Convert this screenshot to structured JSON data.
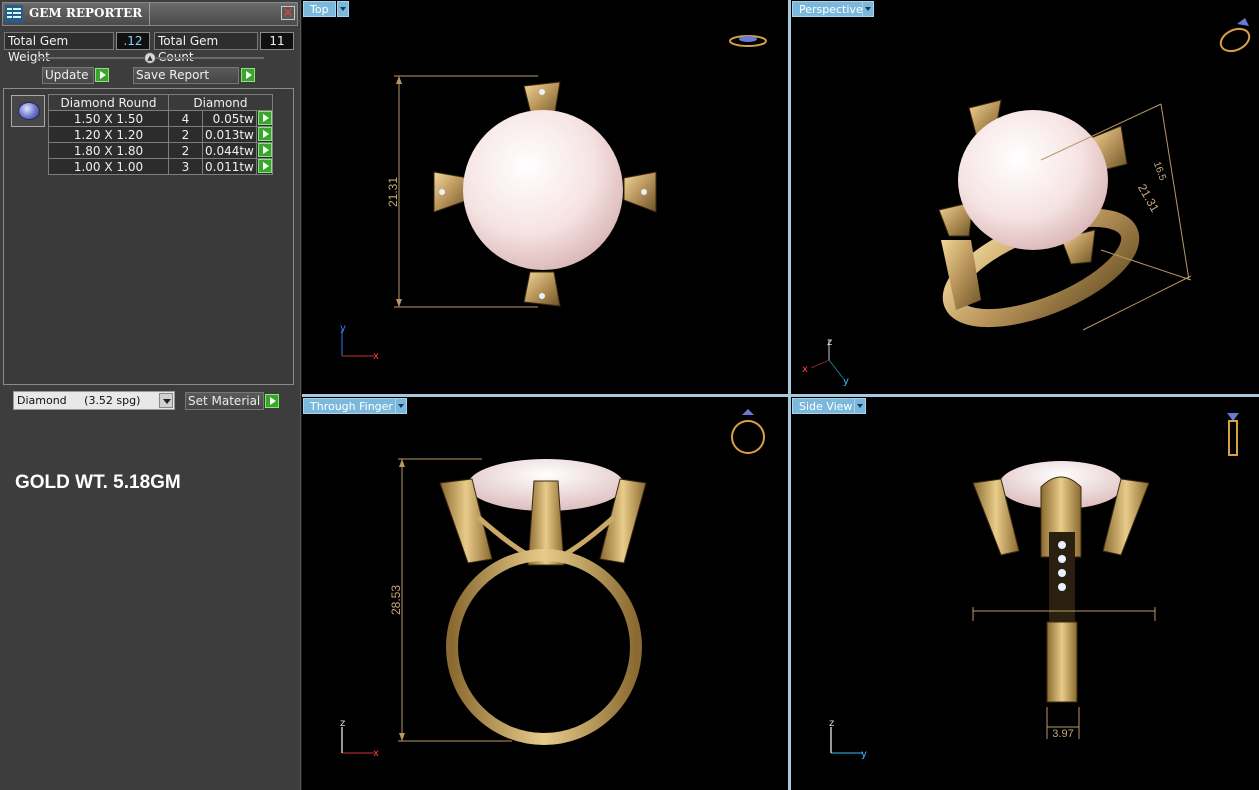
{
  "panel": {
    "title": "GEM REPORTER",
    "total_weight_label": "Total Gem Weight",
    "total_weight_value": ".12",
    "total_count_label": "Total Gem Count",
    "total_count_value": "11",
    "update_label": "Update",
    "save_report_label": "Save Report",
    "table": {
      "headers": [
        "Diamond Round",
        "Diamond"
      ],
      "rows": [
        {
          "size": "1.50 X 1.50",
          "count": "4",
          "weight": "0.05tw"
        },
        {
          "size": "1.20 X 1.20",
          "count": "2",
          "weight": "0.013tw"
        },
        {
          "size": "1.80 X 1.80",
          "count": "2",
          "weight": "0.044tw"
        },
        {
          "size": "1.00 X 1.00",
          "count": "3",
          "weight": "0.011tw"
        }
      ]
    },
    "material_selected": "Diamond     (3.52 spg)",
    "set_material_label": "Set Material",
    "gold_weight": "GOLD WT. 5.18GM"
  },
  "viewports": {
    "top": {
      "label": "Top",
      "dimension": "21.31",
      "axis_a": "y",
      "axis_b": "x"
    },
    "perspective": {
      "label": "Perspective",
      "dimension_a": "21.31",
      "dimension_b": "16.5",
      "axis_a": "z",
      "axis_b": "x",
      "axis_c": "y"
    },
    "through_finger": {
      "label": "Through Finger",
      "dimension": "28.53",
      "axis_a": "z",
      "axis_b": "x"
    },
    "side_view": {
      "label": "Side View",
      "dimension": "3.97",
      "axis_a": "z",
      "axis_b": "y"
    }
  },
  "colors": {
    "gold": "#c9a868",
    "pearl": "#f3dcdc",
    "tab": "#7ab8dc",
    "green_button": "#3aa52d",
    "dimension_line": "#b89868"
  }
}
